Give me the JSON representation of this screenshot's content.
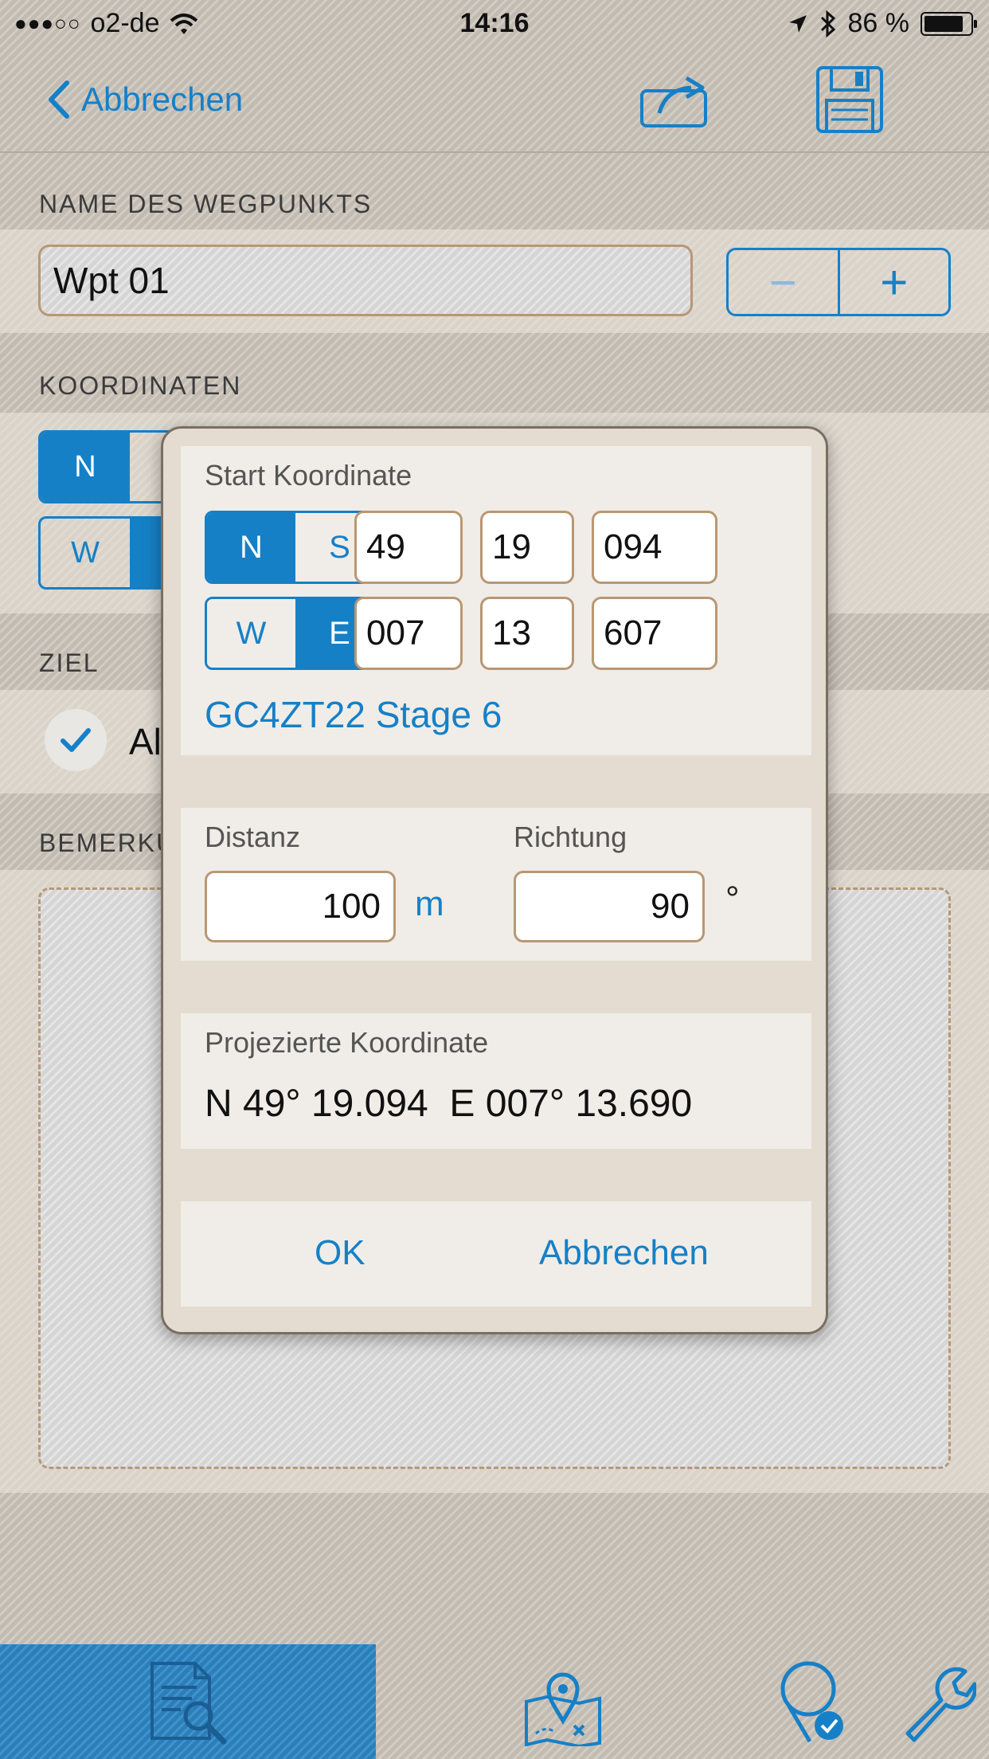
{
  "status_bar": {
    "signal": "●●●○○",
    "carrier": "o2-de",
    "time": "14:16",
    "battery": "86 %",
    "battery_level": 0.86
  },
  "nav": {
    "back_label": "Abbrechen",
    "share_icon": "share-icon",
    "save_icon": "floppy-disk-icon"
  },
  "waypoint": {
    "section_label": "NAME DES WEGPUNKTS",
    "name_value": "Wpt 01",
    "minus": "−",
    "plus": "+"
  },
  "coordinates_section": {
    "label": "KOORDINATEN",
    "lat_hemisphere": "N",
    "lon_hemisphere": "W"
  },
  "target_section": {
    "label": "ZIEL",
    "checkbox_label": "Al"
  },
  "notes_section": {
    "label": "BEMERKU"
  },
  "dialog": {
    "start_label": "Start Koordinate",
    "lat": {
      "hemi_selected": "N",
      "hemi_other": "S",
      "deg": "49",
      "min": "19",
      "dec": "094"
    },
    "lon": {
      "hemi_other": "W",
      "hemi_selected": "E",
      "deg": "007",
      "min": "13",
      "dec": "607"
    },
    "geocache": "GC4ZT22 Stage 6",
    "distance_label": "Distanz",
    "distance_value": "100",
    "distance_unit": "m",
    "direction_label": "Richtung",
    "direction_value": "90",
    "direction_unit": "°",
    "projected_label": "Projezierte Koordinate",
    "projected_value": "N 49° 19.094  E 007° 13.690",
    "ok_label": "OK",
    "cancel_label": "Abbrechen"
  },
  "tabs": [
    {
      "name": "search-document-icon",
      "active": true
    },
    {
      "name": "map-marker-icon",
      "active": false
    },
    {
      "name": "waypoint-check-icon",
      "active": false
    },
    {
      "name": "wrench-icon",
      "active": false
    }
  ],
  "colors": {
    "accent": "#1680c7",
    "background": "#c9c2b8",
    "field_border": "#b99774",
    "dialog_bg": "#e4dcd0",
    "panel_bg": "#f0ede8"
  }
}
